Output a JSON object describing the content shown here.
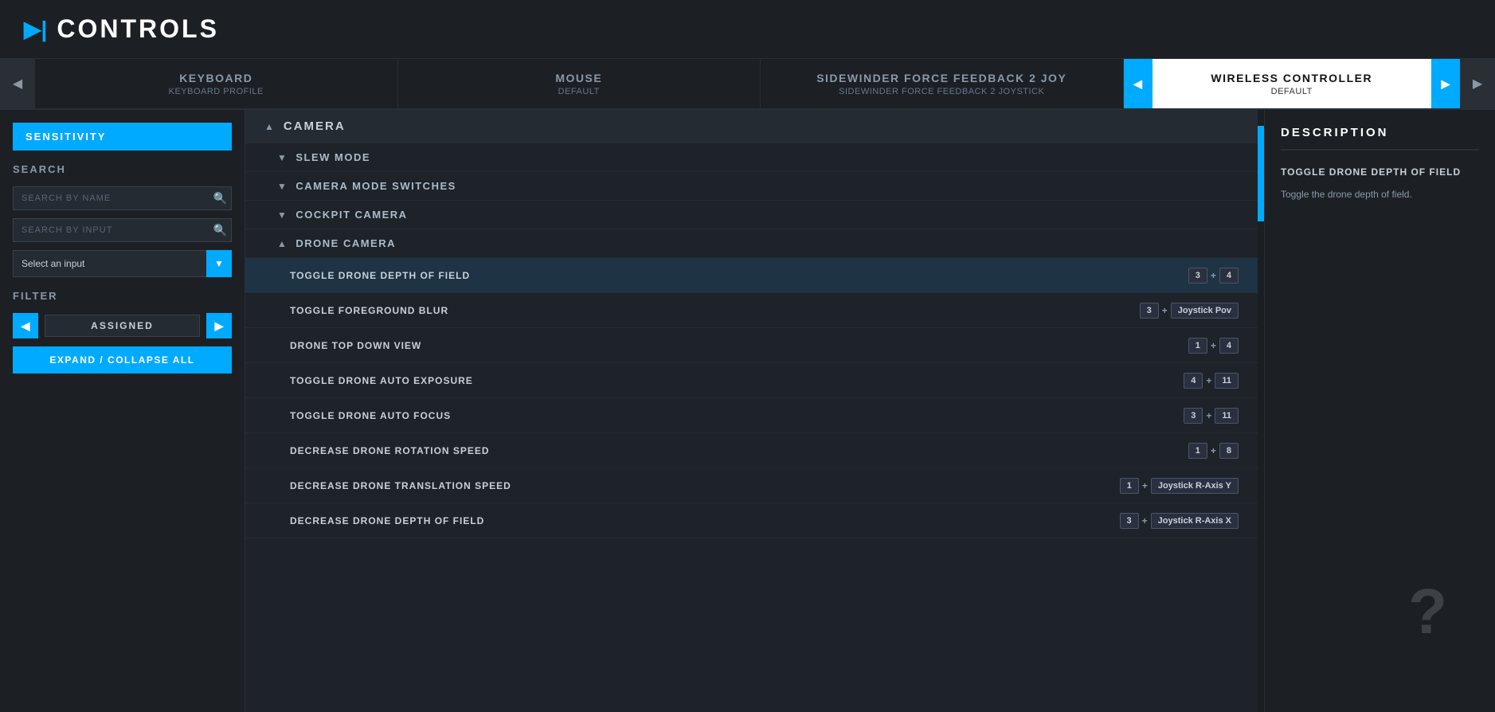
{
  "header": {
    "icon": "▶|",
    "title": "CONTROLS"
  },
  "tabs": [
    {
      "id": "keyboard",
      "label": "KEYBOARD",
      "sublabel": "KEYBOARD PROFILE",
      "active": false
    },
    {
      "id": "mouse",
      "label": "MOUSE",
      "sublabel": "DEFAULT",
      "active": false
    },
    {
      "id": "sidewinder",
      "label": "SIDEWINDER FORCE FEEDBACK 2 JOY",
      "sublabel": "SIDEWINDER FORCE FEEDBACK 2 JOYSTICK",
      "active": false
    },
    {
      "id": "wireless",
      "label": "WIRELESS CONTROLLER",
      "sublabel": "DEFAULT",
      "active": true
    }
  ],
  "sidebar": {
    "sensitivity_label": "SENSITIVITY",
    "search_section_label": "SEARCH",
    "search_by_name_placeholder": "SEARCH BY NAME",
    "search_by_input_placeholder": "SEARCH BY INPUT",
    "select_input_label": "Select an input",
    "filter_section_label": "FILTER",
    "filter_value": "ASSIGNED",
    "expand_collapse_label": "EXPAND / COLLAPSE ALL"
  },
  "bindings": {
    "categories": [
      {
        "id": "camera",
        "label": "CAMERA",
        "expanded": true,
        "subcategories": [
          {
            "id": "slew-mode",
            "label": "SLEW MODE",
            "expanded": false,
            "items": []
          },
          {
            "id": "camera-mode-switches",
            "label": "CAMERA MODE SWITCHES",
            "expanded": false,
            "items": []
          },
          {
            "id": "cockpit-camera",
            "label": "COCKPIT CAMERA",
            "expanded": false,
            "items": []
          },
          {
            "id": "drone-camera",
            "label": "DRONE CAMERA",
            "expanded": true,
            "items": [
              {
                "id": "toggle-drone-dof",
                "name": "TOGGLE DRONE DEPTH OF FIELD",
                "keys": [
                  "3",
                  "+",
                  "4"
                ],
                "selected": true
              },
              {
                "id": "toggle-fg-blur",
                "name": "TOGGLE FOREGROUND BLUR",
                "keys": [
                  "3",
                  "+",
                  "Joystick Pov"
                ],
                "selected": false
              },
              {
                "id": "drone-top-down",
                "name": "DRONE TOP DOWN VIEW",
                "keys": [
                  "1",
                  "+",
                  "4"
                ],
                "selected": false
              },
              {
                "id": "toggle-auto-exposure",
                "name": "TOGGLE DRONE AUTO EXPOSURE",
                "keys": [
                  "4",
                  "+",
                  "11"
                ],
                "selected": false
              },
              {
                "id": "toggle-auto-focus",
                "name": "TOGGLE DRONE AUTO FOCUS",
                "keys": [
                  "3",
                  "+",
                  "11"
                ],
                "selected": false
              },
              {
                "id": "decrease-rotation",
                "name": "DECREASE DRONE ROTATION SPEED",
                "keys": [
                  "1",
                  "+",
                  "8"
                ],
                "selected": false
              },
              {
                "id": "decrease-translation",
                "name": "DECREASE DRONE TRANSLATION SPEED",
                "keys": [
                  "1",
                  "+",
                  "Joystick R-Axis Y"
                ],
                "selected": false
              },
              {
                "id": "decrease-depth",
                "name": "DECREASE DRONE DEPTH OF FIELD",
                "keys": [
                  "3",
                  "+",
                  "Joystick R-Axis X"
                ],
                "selected": false
              }
            ]
          }
        ]
      }
    ]
  },
  "description": {
    "title": "DESCRIPTION",
    "action_name": "TOGGLE DRONE DEPTH OF FIELD",
    "action_text": "Toggle the drone depth of field."
  },
  "colors": {
    "accent": "#00aaff",
    "bg_dark": "#1a1e22",
    "bg_medium": "#1c2025",
    "bg_light": "#252b32"
  }
}
